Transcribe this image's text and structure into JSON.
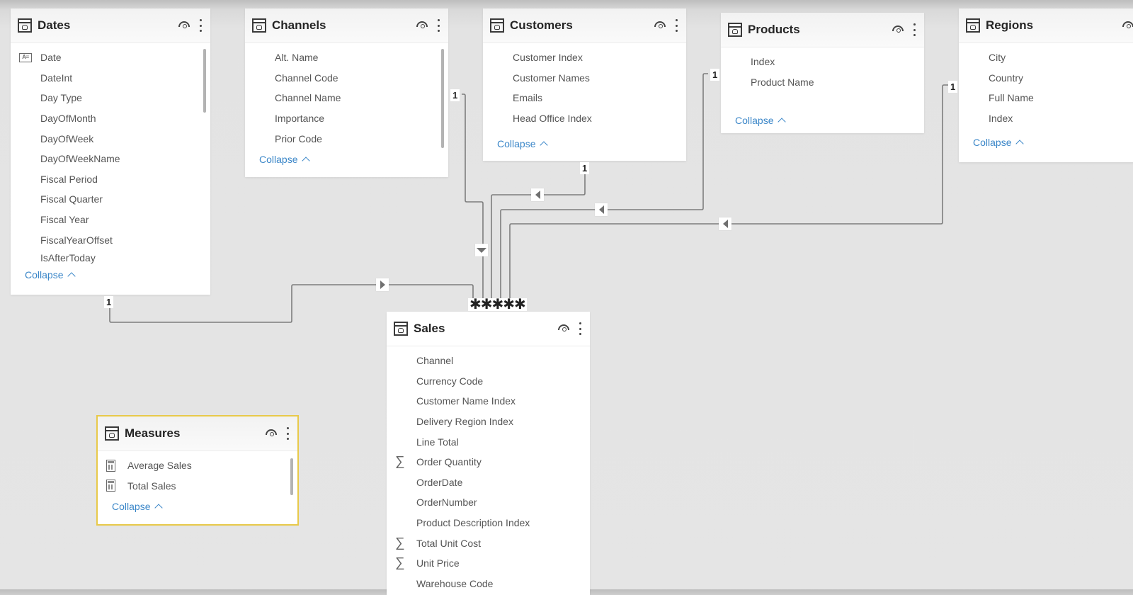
{
  "tables": {
    "dates": {
      "title": "Dates",
      "fields": [
        {
          "name": "Date",
          "icon": "calendar-icon"
        },
        {
          "name": "DateInt",
          "icon": ""
        },
        {
          "name": "Day Type",
          "icon": ""
        },
        {
          "name": "DayOfMonth",
          "icon": ""
        },
        {
          "name": "DayOfWeek",
          "icon": ""
        },
        {
          "name": "DayOfWeekName",
          "icon": ""
        },
        {
          "name": "Fiscal Period",
          "icon": ""
        },
        {
          "name": "Fiscal Quarter",
          "icon": ""
        },
        {
          "name": "Fiscal Year",
          "icon": ""
        },
        {
          "name": "FiscalYearOffset",
          "icon": ""
        },
        {
          "name": "IsAfterToday",
          "icon": ""
        }
      ],
      "collapse_label": "Collapse"
    },
    "channels": {
      "title": "Channels",
      "fields": [
        {
          "name": "Alt. Name"
        },
        {
          "name": "Channel Code"
        },
        {
          "name": "Channel Name"
        },
        {
          "name": "Importance"
        },
        {
          "name": "Prior Code"
        }
      ],
      "collapse_label": "Collapse"
    },
    "customers": {
      "title": "Customers",
      "fields": [
        {
          "name": "Customer Index"
        },
        {
          "name": "Customer Names"
        },
        {
          "name": "Emails"
        },
        {
          "name": "Head Office Index"
        }
      ],
      "collapse_label": "Collapse"
    },
    "products": {
      "title": "Products",
      "fields": [
        {
          "name": "Index"
        },
        {
          "name": "Product Name"
        }
      ],
      "collapse_label": "Collapse"
    },
    "regions": {
      "title": "Regions",
      "fields": [
        {
          "name": "City"
        },
        {
          "name": "Country"
        },
        {
          "name": "Full Name"
        },
        {
          "name": "Index"
        }
      ],
      "collapse_label": "Collapse"
    },
    "sales": {
      "title": "Sales",
      "fields": [
        {
          "name": "Channel",
          "icon": ""
        },
        {
          "name": "Currency Code",
          "icon": ""
        },
        {
          "name": "Customer Name Index",
          "icon": ""
        },
        {
          "name": "Delivery Region Index",
          "icon": ""
        },
        {
          "name": "Line Total",
          "icon": ""
        },
        {
          "name": "Order Quantity",
          "icon": "sigma"
        },
        {
          "name": "OrderDate",
          "icon": ""
        },
        {
          "name": "OrderNumber",
          "icon": ""
        },
        {
          "name": "Product Description Index",
          "icon": ""
        },
        {
          "name": "Total Unit Cost",
          "icon": "sigma"
        },
        {
          "name": "Unit Price",
          "icon": "sigma"
        },
        {
          "name": "Warehouse Code",
          "icon": ""
        }
      ]
    },
    "measures": {
      "title": "Measures",
      "fields": [
        {
          "name": "Average Sales",
          "icon": "calculator"
        },
        {
          "name": "Total Sales",
          "icon": "calculator"
        }
      ],
      "collapse_label": "Collapse"
    }
  },
  "relationships": {
    "one_label": "1",
    "many_label": "*",
    "many_cluster": "✱✱✱✱✱"
  },
  "icons": {
    "sigma": "∑",
    "calendar_text": "A≡"
  },
  "colors": {
    "link": "#3a86c8",
    "selected_outline": "#e8c94a",
    "connector": "#7d7d7d"
  }
}
